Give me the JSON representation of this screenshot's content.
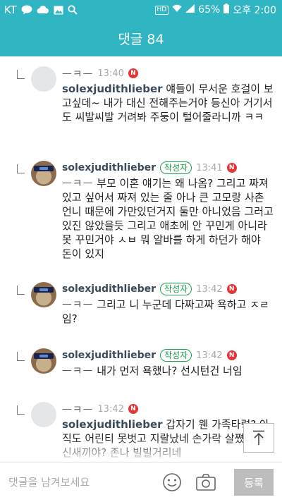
{
  "status_bar": {
    "carrier": "KT",
    "hd": "HD",
    "battery": "65%",
    "time": "오후 2:00"
  },
  "header": {
    "title": "댓글 84"
  },
  "comments": [
    {
      "nickname": "ㅡㅋㅡ",
      "author_badge": "",
      "time": "13:40",
      "new_badge": "N",
      "mention": "",
      "text": "얘들이 무서운 호걸이 보고싶데~ 내가 대신 전해주는거야 등신아 거기서도 씨발씨발 거려봐 주둥이 털어줄라니까 ㅋㅋ",
      "tag": "solexjudithlieber"
    },
    {
      "nickname": "solexjudithlieber",
      "author_badge": "작성자",
      "time": "13:41",
      "new_badge": "N",
      "mention": "ㅡㅋㅡ",
      "text": "부모 이혼 얘기는 왜 나옴? 그리고 짜져 있고 싶어서 짜져 있는 줄 아나 큰 고모랑 사촌언니 때문에 가만있던거지 둘만 아니었음 그러고 있진 않았을듯 그리고 애초에 안 꾸민게 아니라 못 꾸민거야 ㅅㅂ 뭐 알바를 하게 하던가 해야 돈이 있지",
      "tag": ""
    },
    {
      "nickname": "solexjudithlieber",
      "author_badge": "작성자",
      "time": "13:42",
      "new_badge": "N",
      "mention": "ㅡㅋㅡ",
      "text": "그리고 니 누군데 다짜고짜 욕하고 ㅈㄹ임?",
      "tag": ""
    },
    {
      "nickname": "solexjudithlieber",
      "author_badge": "작성자",
      "time": "13:42",
      "new_badge": "N",
      "mention": "ㅡㅋㅡ",
      "text": "내가 먼저 욕했나? 선시턴건 너임",
      "tag": ""
    },
    {
      "nickname": "ㅡㅋㅡ",
      "author_badge": "",
      "time": "13:42",
      "new_badge": "N",
      "mention": "",
      "text": "갑자기 웬 가족타령? 아직도 어린티 못벗고 지랄났네 손가락 살쪘냐 등신새끼야? 존나 빌빌거리네",
      "tag": "solexjudithlieber"
    }
  ],
  "bottom_bar": {
    "input_placeholder": "댓글을 남겨보세요",
    "submit_label": "등록"
  },
  "colors": {
    "accent": "#30b5c3",
    "new_badge": "#e33636",
    "author_badge": "#1aa34a"
  },
  "icons": [
    "kakaotalk-icon",
    "cloud-icon",
    "image-icon",
    "search-icon",
    "wifi-icon",
    "signal-icon",
    "battery-icon",
    "reply-arrow-icon",
    "scroll-top-icon",
    "emoji-icon",
    "camera-icon"
  ]
}
